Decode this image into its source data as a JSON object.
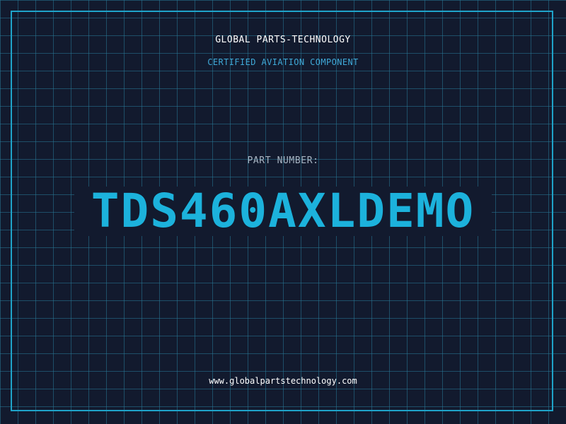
{
  "header": {
    "company": "GLOBAL PARTS-TECHNOLOGY",
    "tagline": "CERTIFIED AVIATION COMPONENT"
  },
  "part": {
    "label": "PART NUMBER:",
    "number": "TDS460AXLDEMO"
  },
  "footer": {
    "url": "www.globalpartstechnology.com"
  },
  "colors": {
    "background": "#121a2e",
    "grid": "#28789a",
    "frame": "#1fa3c9",
    "accent": "#1cb2dc",
    "tagline": "#3fa9d8",
    "label": "#a7b4c2",
    "text": "#ffffff"
  }
}
